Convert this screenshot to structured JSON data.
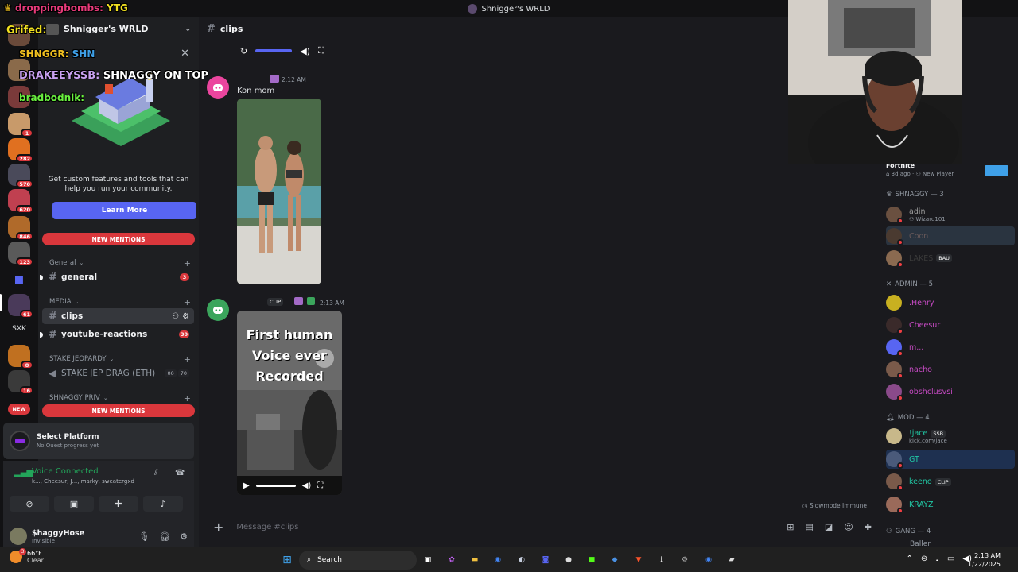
{
  "window": {
    "title": "Shnigger's WRLD"
  },
  "guilds": {
    "badges": [
      "1",
      "282",
      "570",
      "620",
      "846",
      "123",
      "61",
      "8",
      "16"
    ],
    "text_server": "SXK",
    "new_label": "NEW"
  },
  "sidebar": {
    "server_name": "Shnigger's WRLD",
    "promo_text": "Get custom features and tools that can help you run your community.",
    "learn_more": "Learn More",
    "new_mentions": "NEW MENTIONS",
    "categories": [
      "General",
      "MEDIA",
      "STAKE JEOPARDY",
      "SHNAGGY PRIV"
    ],
    "channels": {
      "general": {
        "name": "general",
        "count": "3"
      },
      "clips": {
        "name": "clips"
      },
      "youtube": {
        "name": "youtube-reactions",
        "count": "30"
      },
      "stake": {
        "name": "STAKE JEP DRAG (ETH)",
        "v1": "00",
        "v2": "70"
      }
    },
    "quest": {
      "title": "Select Platform",
      "subtitle": "No Quest progress yet"
    },
    "voice": {
      "status": "Voice Connected",
      "users": "k..., Cheesur, J..., marky, sweatergxd"
    },
    "user": {
      "name": "$haggyHose",
      "status": "Invisible"
    }
  },
  "chat": {
    "channel": "clips",
    "messages": [
      {
        "time": "2:12 AM",
        "text": "Kon mom"
      },
      {
        "time": "2:13 AM",
        "tag": "CLIP",
        "video_text": "First human Voice ever Recorded"
      }
    ],
    "slowmode": "Slowmode Immune",
    "placeholder": "Message #clips"
  },
  "members": {
    "activity_title": "Fortnite",
    "activity_sub": "3d ago",
    "activity_sub2": "New Player",
    "sections": [
      {
        "label": "SHNAGGY — 3"
      },
      {
        "label": "ADMIN — 5"
      },
      {
        "label": "MOD — 4"
      },
      {
        "label": "GANG — 4"
      }
    ],
    "shnaggy": [
      {
        "name": "adin",
        "sub": "Wizard101",
        "color": "#9b9b9b"
      },
      {
        "name": "Coon",
        "sub": "",
        "color": "#6a5a5a"
      },
      {
        "name": "LAKES",
        "sub": "",
        "tag": "BAU",
        "color": "#3a3a3a"
      }
    ],
    "admin": [
      {
        "name": ".Henry",
        "color": "#c74ac4"
      },
      {
        "name": "Cheesur",
        "color": "#c74ac4"
      },
      {
        "name": "m...",
        "color": "#c74ac4"
      },
      {
        "name": "nacho",
        "color": "#c74ac4"
      },
      {
        "name": "obshclusvsi",
        "color": "#c74ac4"
      }
    ],
    "mod": [
      {
        "name": "!jace",
        "sub": "kick.com/jace",
        "tag": "SSB",
        "color": "#21c8a5"
      },
      {
        "name": "GT",
        "sub": "",
        "color": "#21c8a5"
      },
      {
        "name": "keeno",
        "sub": "",
        "tag": "CLIP",
        "color": "#21c8a5"
      },
      {
        "name": "KRAYZ",
        "sub": "",
        "color": "#21c8a5"
      }
    ],
    "gang_first": "Baller"
  },
  "overlay": {
    "line1_user": "droppingbombs:",
    "line1_msg": "YTG",
    "line2_user": "Grifed:",
    "line3_user": "SHNGGR:",
    "line3_msg": "SHN",
    "line4_user": "DRAKEEYSSB:",
    "line4_msg": "SHNAGGY ON TOP",
    "line5_user": "bradbodnik:"
  },
  "taskbar": {
    "temp": "66°F",
    "condition": "Clear",
    "weather_badge": "3",
    "search": "Search",
    "time": "2:13 AM",
    "date": "11/22/2025"
  }
}
